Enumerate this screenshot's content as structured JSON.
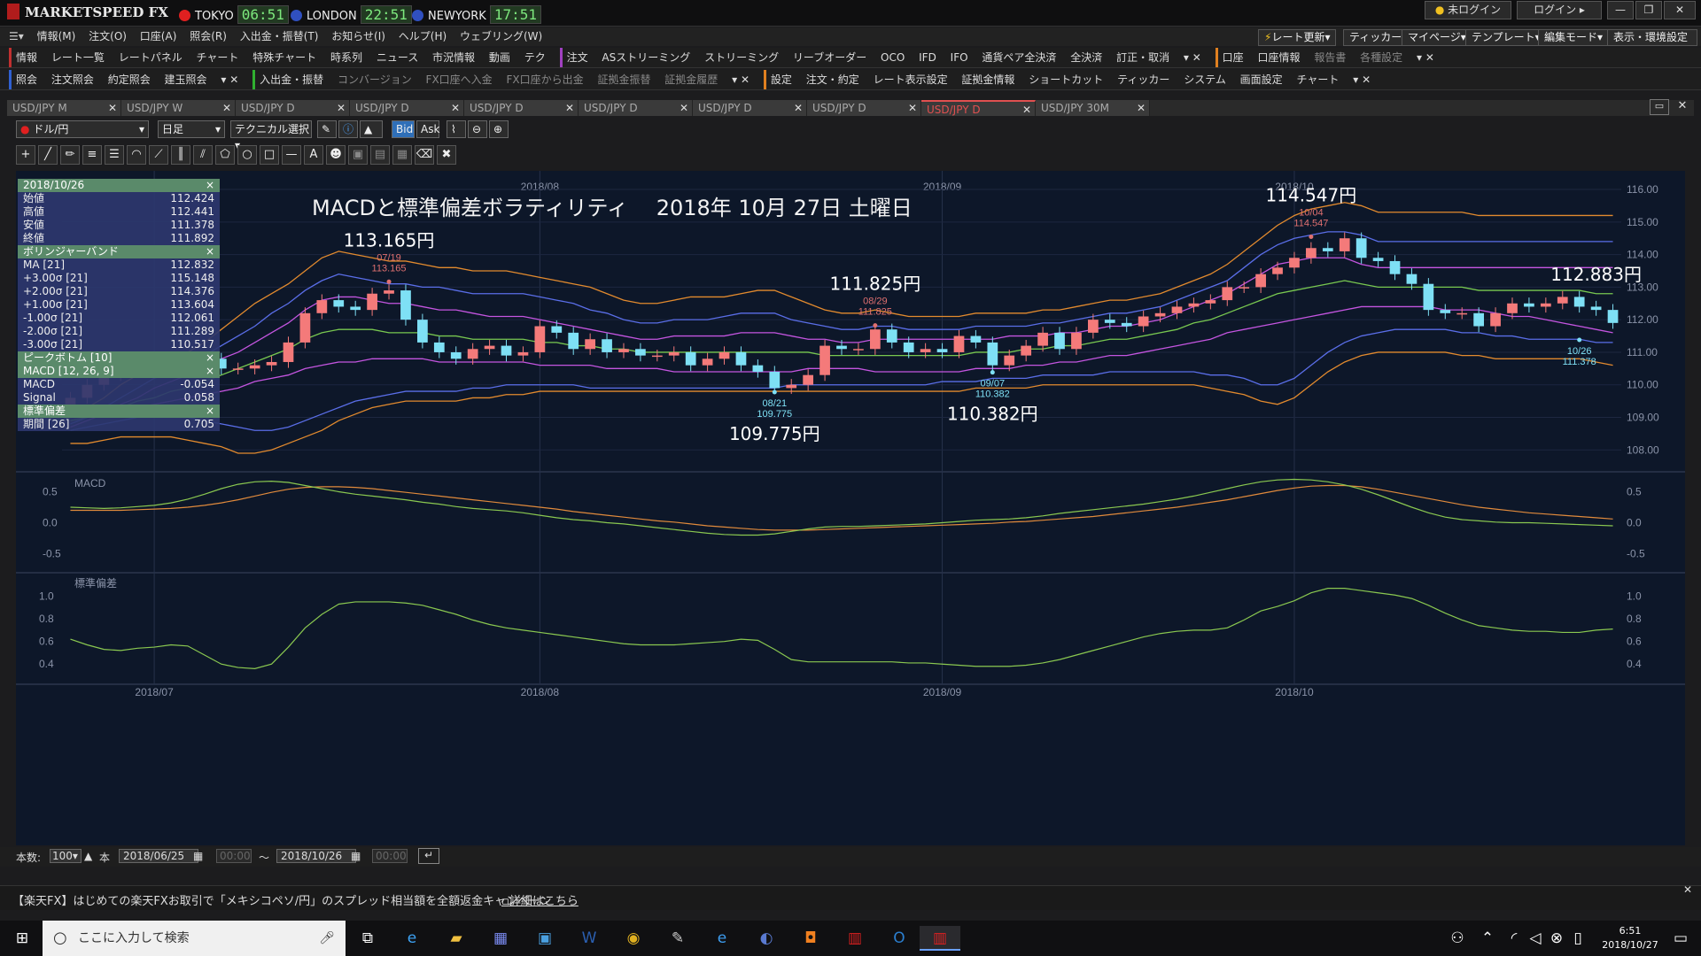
{
  "app": {
    "title": "MARKETSPEED FX"
  },
  "clocks": [
    {
      "city": "TOKYO",
      "time": "06:51",
      "color": "#e02020"
    },
    {
      "city": "LONDON",
      "time": "22:51",
      "color": "#3050c0"
    },
    {
      "city": "NEWYORK",
      "time": "17:51",
      "color": "#3050c0"
    }
  ],
  "window_buttons": {
    "login_status": "未ログイン",
    "login": "ログイン"
  },
  "menu": [
    "情報(M)",
    "注文(O)",
    "口座(A)",
    "照会(R)",
    "入出金・振替(T)",
    "お知らせ(I)",
    "ヘルプ(H)",
    "ウェブリング(W)"
  ],
  "right_buttons": [
    "レート更新",
    "ティッカー",
    "マイページ",
    "テンプレート",
    "編集モード",
    "表示・環境設定"
  ],
  "toolbar1": [
    "情報",
    "レート一覧",
    "レートパネル",
    "チャート",
    "特殊チャート",
    "時系列",
    "ニュース",
    "市況情報",
    "動画",
    "テク",
    "注文",
    "ASストリーミング",
    "ストリーミング",
    "リーブオーダー",
    "OCO",
    "IFD",
    "IFO",
    "通貨ペア全決済",
    "全決済",
    "訂正・取消",
    "口座",
    "口座情報",
    "報告書",
    "各種設定"
  ],
  "toolbar2": [
    "照会",
    "注文照会",
    "約定照会",
    "建玉照会",
    "入出金・振替",
    "コンバージョン",
    "FX口座へ入金",
    "FX口座から出金",
    "証拠金振替",
    "証拠金履歴",
    "設定",
    "注文・約定",
    "レート表示設定",
    "証拠金情報",
    "ショートカット",
    "ティッカー",
    "システム",
    "画面設定",
    "チャート"
  ],
  "tabs": [
    "USD/JPY M",
    "USD/JPY W",
    "USD/JPY D",
    "USD/JPY D",
    "USD/JPY D",
    "USD/JPY D",
    "USD/JPY D",
    "USD/JPY D",
    "USD/JPY D",
    "USD/JPY 30M"
  ],
  "active_tab": 8,
  "controls": {
    "pair": "ドル/円",
    "period": "日足",
    "technical": "テクニカル選択",
    "bid": "Bid",
    "ask": "Ask"
  },
  "info": {
    "date": "2018/10/26",
    "ohlc": [
      {
        "label": "始値",
        "value": "112.424"
      },
      {
        "label": "高値",
        "value": "112.441"
      },
      {
        "label": "安値",
        "value": "111.378"
      },
      {
        "label": "終値",
        "value": "111.892"
      }
    ],
    "bb_title": "ボリンジャーバンド",
    "bb": [
      {
        "label": "MA [21]",
        "value": "112.832"
      },
      {
        "label": "+3.00σ [21]",
        "value": "115.148"
      },
      {
        "label": "+2.00σ [21]",
        "value": "114.376"
      },
      {
        "label": "+1.00σ [21]",
        "value": "113.604"
      },
      {
        "label": "-1.00σ [21]",
        "value": "112.061"
      },
      {
        "label": "-2.00σ [21]",
        "value": "111.289"
      },
      {
        "label": "-3.00σ [21]",
        "value": "110.517"
      }
    ],
    "peak_title": "ピークボトム [10]",
    "macd_title": "MACD [12, 26, 9]",
    "macd": [
      {
        "label": "MACD",
        "value": "-0.054"
      },
      {
        "label": "Signal",
        "value": "0.058"
      }
    ],
    "sd_title": "標準偏差",
    "sd": [
      {
        "label": "期間 [26]",
        "value": "0.705"
      }
    ]
  },
  "chart_data": {
    "type": "candlestick",
    "title": "MACDと標準偏差ボラティリティ　 2018年 10月 27日 土曜日",
    "y_range": [
      107.6,
      116.3
    ],
    "y_ticks": [
      "116.00",
      "115.00",
      "114.00",
      "113.00",
      "112.00",
      "111.00",
      "110.00",
      "109.00",
      "108.00"
    ],
    "month_labels": [
      {
        "label": "2018/07",
        "i": 5
      },
      {
        "label": "2018/08",
        "i": 28
      },
      {
        "label": "2018/09",
        "i": 52
      },
      {
        "label": "2018/10",
        "i": 73
      }
    ],
    "annotations": [
      {
        "big": "113.165円",
        "date": "07/19",
        "price": "113.165",
        "i": 19,
        "y": 113.165,
        "pos": "above"
      },
      {
        "big": "109.775円",
        "date": "08/21",
        "price": "109.775",
        "i": 42,
        "y": 109.775,
        "pos": "below"
      },
      {
        "big": "111.825円",
        "date": "08/29",
        "price": "111.825",
        "i": 48,
        "y": 111.825,
        "pos": "above"
      },
      {
        "big": "110.382円",
        "date": "09/07",
        "price": "110.382",
        "i": 55,
        "y": 110.382,
        "pos": "below"
      },
      {
        "big": "114.547円",
        "date": "10/04",
        "price": "114.547",
        "i": 74,
        "y": 114.547,
        "pos": "above"
      },
      {
        "big": "112.883円",
        "date": "",
        "price": "",
        "i": 91,
        "y": 113.2,
        "pos": "label"
      },
      {
        "big": "",
        "date": "10/26",
        "price": "111.378",
        "i": 90,
        "y": 111.378,
        "pos": "below"
      }
    ],
    "close": [
      109.6,
      110.0,
      110.3,
      110.5,
      110.6,
      110.5,
      110.4,
      110.6,
      110.8,
      110.5,
      110.5,
      110.6,
      110.7,
      111.3,
      112.2,
      112.6,
      112.4,
      112.3,
      112.8,
      112.9,
      112.0,
      111.3,
      111.0,
      110.8,
      111.1,
      111.2,
      110.9,
      111.0,
      111.8,
      111.6,
      111.1,
      111.4,
      111.0,
      111.1,
      110.9,
      110.9,
      111.0,
      110.6,
      110.8,
      111.0,
      110.6,
      110.4,
      109.9,
      110.0,
      110.3,
      111.2,
      111.1,
      111.1,
      111.7,
      111.3,
      111.0,
      111.1,
      111.0,
      111.5,
      111.3,
      110.6,
      110.9,
      111.2,
      111.6,
      111.1,
      111.6,
      112.0,
      111.9,
      111.8,
      112.1,
      112.2,
      112.4,
      112.5,
      112.6,
      113.0,
      113.0,
      113.4,
      113.6,
      113.9,
      114.2,
      114.1,
      114.5,
      113.9,
      113.8,
      113.4,
      113.1,
      112.3,
      112.2,
      112.2,
      111.8,
      112.2,
      112.5,
      112.4,
      112.5,
      112.7,
      112.4,
      112.3,
      111.9
    ],
    "bb_upper3": [
      109.0,
      109.3,
      109.6,
      110.0,
      110.3,
      110.6,
      110.8,
      111.0,
      111.3,
      111.7,
      112.1,
      112.5,
      112.8,
      113.1,
      113.5,
      113.9,
      114.1,
      114.0,
      113.9,
      113.8,
      113.8,
      113.7,
      113.6,
      113.6,
      113.5,
      113.5,
      113.5,
      113.4,
      113.3,
      113.2,
      113.1,
      113.0,
      112.8,
      112.6,
      112.5,
      112.5,
      112.6,
      112.7,
      112.7,
      112.7,
      112.8,
      112.9,
      112.9,
      112.7,
      112.5,
      112.3,
      112.2,
      112.2,
      112.3,
      112.2,
      112.1,
      112.1,
      112.1,
      112.1,
      112.2,
      112.2,
      112.2,
      112.2,
      112.3,
      112.3,
      112.4,
      112.5,
      112.6,
      112.6,
      112.7,
      112.8,
      113.0,
      113.2,
      113.4,
      113.7,
      114.1,
      114.5,
      114.9,
      115.2,
      115.4,
      115.5,
      115.6,
      115.5,
      115.3,
      115.3,
      115.3,
      115.3,
      115.3,
      115.3,
      115.2,
      115.2,
      115.2,
      115.2,
      115.2,
      115.2,
      115.2,
      115.2,
      115.2
    ],
    "bb_upper2": [
      108.8,
      109.0,
      109.3,
      109.6,
      109.9,
      110.2,
      110.4,
      110.6,
      110.9,
      111.2,
      111.5,
      111.8,
      112.2,
      112.5,
      112.9,
      113.2,
      113.4,
      113.3,
      113.2,
      113.1,
      113.1,
      113.0,
      113.0,
      112.9,
      112.8,
      112.8,
      112.8,
      112.8,
      112.7,
      112.6,
      112.5,
      112.3,
      112.2,
      112.0,
      111.9,
      111.9,
      112.0,
      112.0,
      112.0,
      112.1,
      112.2,
      112.2,
      112.2,
      112.0,
      111.9,
      111.8,
      111.7,
      111.7,
      111.8,
      111.8,
      111.7,
      111.7,
      111.7,
      111.7,
      111.8,
      111.8,
      111.8,
      111.8,
      111.9,
      111.9,
      112.0,
      112.1,
      112.2,
      112.2,
      112.3,
      112.4,
      112.6,
      112.8,
      113.0,
      113.2,
      113.6,
      114.0,
      114.3,
      114.5,
      114.6,
      114.7,
      114.7,
      114.6,
      114.4,
      114.4,
      114.4,
      114.4,
      114.4,
      114.4,
      114.4,
      114.4,
      114.4,
      114.4,
      114.4,
      114.4,
      114.4,
      114.4,
      114.4
    ],
    "bb_upper1": [
      108.7,
      108.9,
      109.1,
      109.4,
      109.6,
      109.9,
      110.1,
      110.3,
      110.5,
      110.8,
      111.0,
      111.3,
      111.6,
      111.9,
      112.3,
      112.6,
      112.7,
      112.7,
      112.6,
      112.5,
      112.5,
      112.4,
      112.3,
      112.3,
      112.2,
      112.1,
      112.1,
      112.1,
      112.0,
      111.9,
      111.8,
      111.7,
      111.6,
      111.5,
      111.4,
      111.4,
      111.5,
      111.5,
      111.5,
      111.5,
      111.6,
      111.6,
      111.6,
      111.5,
      111.4,
      111.4,
      111.3,
      111.3,
      111.4,
      111.4,
      111.4,
      111.4,
      111.4,
      111.4,
      111.4,
      111.4,
      111.5,
      111.5,
      111.5,
      111.6,
      111.6,
      111.7,
      111.8,
      111.8,
      111.9,
      112.0,
      112.2,
      112.4,
      112.6,
      112.8,
      113.1,
      113.4,
      113.7,
      113.8,
      113.9,
      113.9,
      113.9,
      113.7,
      113.6,
      113.6,
      113.6,
      113.6,
      113.6,
      113.6,
      113.6,
      113.6,
      113.6,
      113.6,
      113.6,
      113.6,
      113.6,
      113.6,
      113.6
    ],
    "bb_mid": [
      108.9,
      109.0,
      109.1,
      109.3,
      109.5,
      109.6,
      109.8,
      109.9,
      110.1,
      110.3,
      110.5,
      110.7,
      110.9,
      111.1,
      111.4,
      111.6,
      111.7,
      111.7,
      111.7,
      111.6,
      111.6,
      111.6,
      111.5,
      111.5,
      111.4,
      111.4,
      111.4,
      111.4,
      111.3,
      111.3,
      111.2,
      111.2,
      111.1,
      111.1,
      111.0,
      111.0,
      111.0,
      111.0,
      111.0,
      111.0,
      111.0,
      111.0,
      111.0,
      111.0,
      111.0,
      110.9,
      110.9,
      110.9,
      110.9,
      110.9,
      110.9,
      110.9,
      110.9,
      110.9,
      111.0,
      111.0,
      111.0,
      111.1,
      111.1,
      111.2,
      111.2,
      111.3,
      111.4,
      111.4,
      111.5,
      111.6,
      111.7,
      111.9,
      112.0,
      112.2,
      112.4,
      112.6,
      112.8,
      112.9,
      113.0,
      113.1,
      113.2,
      113.1,
      113.0,
      113.0,
      113.0,
      113.0,
      113.0,
      113.0,
      112.9,
      112.9,
      112.9,
      112.9,
      112.9,
      112.9,
      112.9,
      112.8,
      112.8
    ],
    "bb_lower1": [
      109.0,
      109.1,
      109.1,
      109.2,
      109.3,
      109.4,
      109.5,
      109.6,
      109.7,
      109.8,
      109.9,
      110.1,
      110.2,
      110.3,
      110.5,
      110.6,
      110.7,
      110.7,
      110.8,
      110.8,
      110.8,
      110.8,
      110.7,
      110.7,
      110.7,
      110.7,
      110.7,
      110.7,
      110.6,
      110.6,
      110.6,
      110.6,
      110.5,
      110.5,
      110.5,
      110.5,
      110.4,
      110.4,
      110.4,
      110.4,
      110.4,
      110.4,
      110.4,
      110.4,
      110.5,
      110.5,
      110.5,
      110.5,
      110.4,
      110.4,
      110.4,
      110.4,
      110.4,
      110.4,
      110.5,
      110.5,
      110.5,
      110.6,
      110.6,
      110.7,
      110.7,
      110.8,
      110.9,
      110.9,
      111.0,
      111.1,
      111.2,
      111.3,
      111.4,
      111.6,
      111.7,
      111.8,
      111.9,
      112.0,
      112.1,
      112.2,
      112.3,
      112.4,
      112.4,
      112.4,
      112.4,
      112.4,
      112.3,
      112.3,
      112.3,
      112.2,
      112.1,
      112.1,
      112.0,
      111.9,
      111.8,
      111.7,
      111.6
    ],
    "bb_lower2": [
      108.6,
      108.7,
      108.8,
      108.9,
      109.0,
      109.0,
      109.0,
      109.0,
      108.9,
      108.8,
      108.7,
      108.6,
      108.6,
      108.7,
      108.9,
      109.1,
      109.3,
      109.5,
      109.6,
      109.7,
      109.8,
      109.8,
      109.8,
      109.8,
      109.9,
      109.9,
      110.0,
      110.0,
      110.0,
      110.0,
      110.0,
      109.9,
      109.9,
      109.9,
      109.9,
      109.9,
      109.9,
      109.9,
      109.9,
      109.9,
      109.9,
      109.9,
      109.9,
      110.0,
      110.0,
      110.0,
      110.0,
      110.0,
      110.0,
      110.0,
      110.0,
      110.0,
      110.1,
      110.1,
      110.1,
      110.2,
      110.2,
      110.2,
      110.3,
      110.3,
      110.3,
      110.3,
      110.4,
      110.4,
      110.4,
      110.4,
      110.4,
      110.4,
      110.3,
      110.3,
      110.2,
      110.0,
      110.0,
      110.2,
      110.6,
      111.0,
      111.3,
      111.5,
      111.6,
      111.7,
      111.7,
      111.7,
      111.7,
      111.6,
      111.6,
      111.5,
      111.5,
      111.4,
      111.4,
      111.4,
      111.4,
      111.3,
      111.3
    ],
    "bb_lower3": [
      108.2,
      108.2,
      108.3,
      108.4,
      108.4,
      108.4,
      108.4,
      108.3,
      108.2,
      108.1,
      107.9,
      107.9,
      108.0,
      108.2,
      108.4,
      108.6,
      108.9,
      109.1,
      109.3,
      109.4,
      109.5,
      109.5,
      109.5,
      109.5,
      109.6,
      109.6,
      109.7,
      109.7,
      109.8,
      109.8,
      109.8,
      109.8,
      109.8,
      109.8,
      109.8,
      109.8,
      109.8,
      109.8,
      109.8,
      109.8,
      109.8,
      109.8,
      109.8,
      109.8,
      109.8,
      109.8,
      109.8,
      109.8,
      109.8,
      109.8,
      109.8,
      109.8,
      109.8,
      109.8,
      109.9,
      109.9,
      109.9,
      109.9,
      110.0,
      110.0,
      110.0,
      110.0,
      110.0,
      110.0,
      110.0,
      110.0,
      110.0,
      110.0,
      109.9,
      109.8,
      109.7,
      109.5,
      109.4,
      109.6,
      110.0,
      110.4,
      110.7,
      110.9,
      111.0,
      111.0,
      111.0,
      111.0,
      111.0,
      110.9,
      110.9,
      110.8,
      110.8,
      110.8,
      110.8,
      110.8,
      110.8,
      110.7,
      110.6
    ],
    "macd": [
      0.25,
      0.24,
      0.23,
      0.24,
      0.26,
      0.28,
      0.32,
      0.38,
      0.46,
      0.55,
      0.62,
      0.66,
      0.67,
      0.65,
      0.6,
      0.55,
      0.5,
      0.46,
      0.43,
      0.4,
      0.37,
      0.33,
      0.3,
      0.26,
      0.23,
      0.21,
      0.19,
      0.16,
      0.12,
      0.08,
      0.05,
      0.03,
      0.0,
      -0.02,
      -0.05,
      -0.08,
      -0.11,
      -0.14,
      -0.17,
      -0.19,
      -0.2,
      -0.2,
      -0.18,
      -0.14,
      -0.1,
      -0.07,
      -0.06,
      -0.06,
      -0.05,
      -0.04,
      -0.03,
      -0.02,
      0.0,
      0.02,
      0.04,
      0.05,
      0.06,
      0.08,
      0.11,
      0.15,
      0.18,
      0.21,
      0.24,
      0.27,
      0.3,
      0.34,
      0.38,
      0.43,
      0.49,
      0.55,
      0.61,
      0.66,
      0.69,
      0.7,
      0.69,
      0.66,
      0.61,
      0.54,
      0.45,
      0.35,
      0.25,
      0.16,
      0.09,
      0.05,
      0.03,
      0.01,
      0.0,
      0.0,
      -0.01,
      -0.02,
      -0.03,
      -0.04,
      -0.05
    ],
    "signal": [
      0.2,
      0.2,
      0.2,
      0.2,
      0.21,
      0.22,
      0.23,
      0.25,
      0.28,
      0.32,
      0.37,
      0.43,
      0.49,
      0.54,
      0.57,
      0.58,
      0.58,
      0.57,
      0.55,
      0.52,
      0.49,
      0.46,
      0.43,
      0.4,
      0.37,
      0.34,
      0.31,
      0.28,
      0.25,
      0.22,
      0.18,
      0.15,
      0.12,
      0.09,
      0.06,
      0.03,
      0.01,
      -0.02,
      -0.05,
      -0.07,
      -0.09,
      -0.11,
      -0.12,
      -0.12,
      -0.12,
      -0.11,
      -0.1,
      -0.09,
      -0.08,
      -0.07,
      -0.06,
      -0.05,
      -0.04,
      -0.03,
      -0.02,
      -0.01,
      0.01,
      0.02,
      0.04,
      0.06,
      0.08,
      0.1,
      0.13,
      0.16,
      0.19,
      0.22,
      0.25,
      0.29,
      0.33,
      0.37,
      0.42,
      0.47,
      0.52,
      0.56,
      0.59,
      0.6,
      0.6,
      0.58,
      0.54,
      0.49,
      0.44,
      0.39,
      0.34,
      0.29,
      0.25,
      0.22,
      0.19,
      0.16,
      0.14,
      0.12,
      0.1,
      0.08,
      0.06
    ],
    "stddev": [
      0.62,
      0.57,
      0.53,
      0.52,
      0.54,
      0.55,
      0.57,
      0.56,
      0.48,
      0.4,
      0.37,
      0.36,
      0.4,
      0.55,
      0.72,
      0.84,
      0.93,
      0.95,
      0.95,
      0.95,
      0.94,
      0.92,
      0.88,
      0.84,
      0.79,
      0.75,
      0.72,
      0.7,
      0.68,
      0.66,
      0.64,
      0.62,
      0.6,
      0.58,
      0.57,
      0.57,
      0.57,
      0.58,
      0.59,
      0.6,
      0.62,
      0.61,
      0.53,
      0.44,
      0.42,
      0.42,
      0.42,
      0.42,
      0.42,
      0.42,
      0.41,
      0.41,
      0.4,
      0.39,
      0.38,
      0.38,
      0.38,
      0.39,
      0.41,
      0.44,
      0.48,
      0.52,
      0.56,
      0.6,
      0.64,
      0.67,
      0.69,
      0.7,
      0.7,
      0.72,
      0.79,
      0.87,
      0.91,
      0.96,
      1.03,
      1.07,
      1.07,
      1.05,
      1.03,
      1.01,
      0.98,
      0.92,
      0.85,
      0.79,
      0.74,
      0.72,
      0.7,
      0.69,
      0.69,
      0.68,
      0.68,
      0.7,
      0.71
    ],
    "macd_label": "MACD",
    "macd_ticks": [
      "0.5",
      "0.0",
      "-0.5"
    ],
    "sd_label": "標準偏差",
    "sd_ticks": [
      "1.0",
      "0.8",
      "0.6",
      "0.4"
    ],
    "colors": {
      "up": "#f47a7a",
      "down": "#7ee0f5",
      "bb3": "#e28a2e",
      "bb2": "#5a6ee8",
      "bb1": "#c455e0",
      "mid": "#78c850",
      "macd": "#8ac850",
      "signal": "#e08a3c"
    }
  },
  "bottom": {
    "count_label": "本数:",
    "count": "100",
    "unit": "本",
    "from": "2018/06/25",
    "time1": "00:00",
    "sep": "〜",
    "to": "2018/10/26",
    "time2": "00:00"
  },
  "news": "【楽天FX】はじめての楽天FXお取引で「メキシコペソ/円」のスプレッド相当額を全額返金キャンペーン",
  "news_link": "詳細はこちら",
  "taskbar": {
    "search": "ここに入力して検索",
    "time": "6:51",
    "date": "2018/10/27"
  }
}
